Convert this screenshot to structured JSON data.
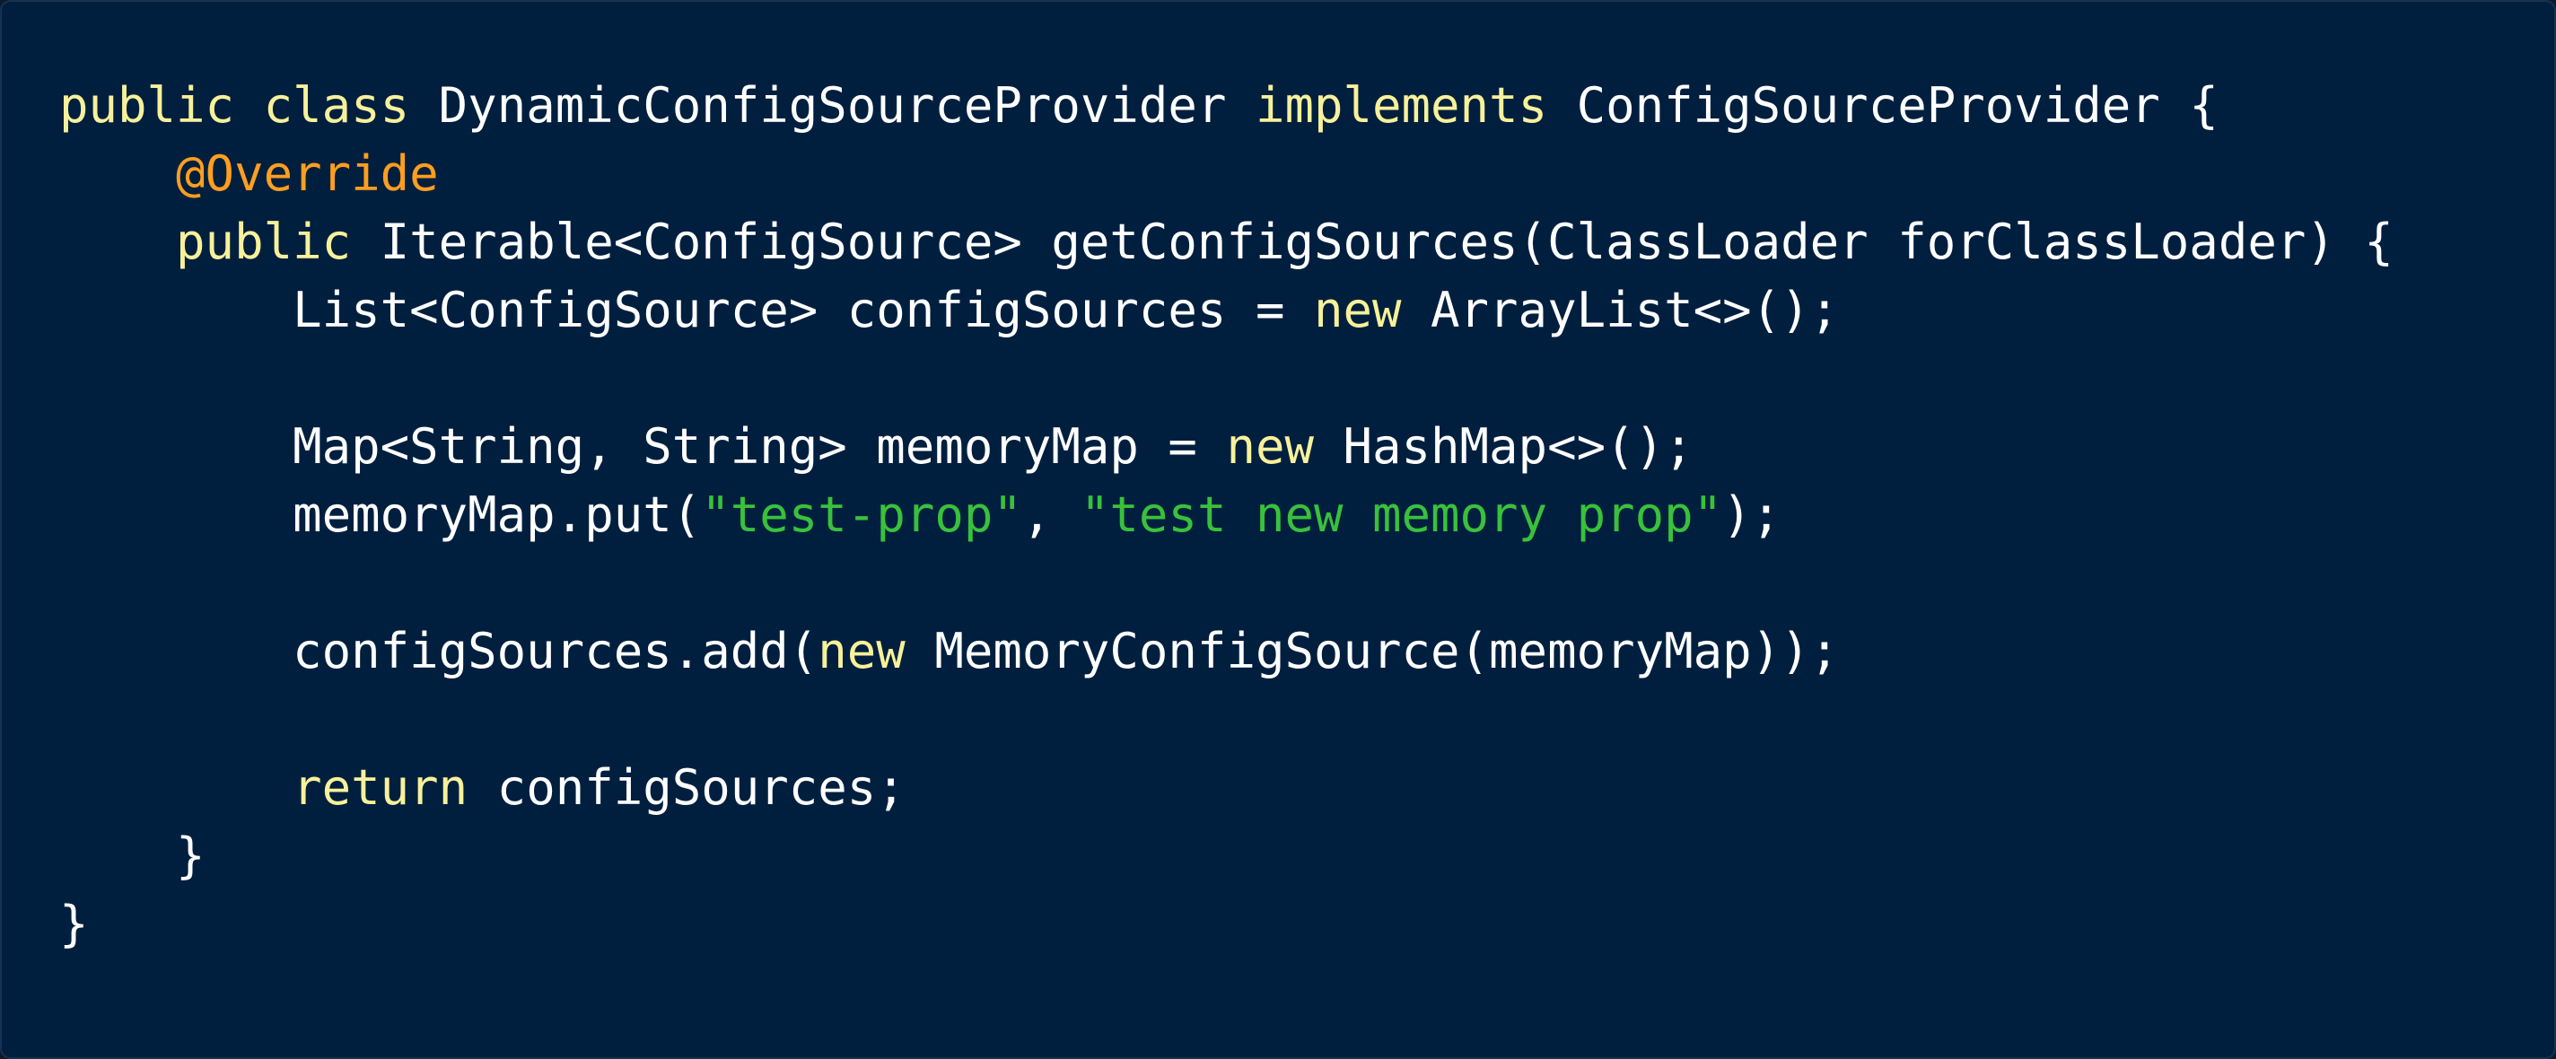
{
  "colors": {
    "background": "#001f3f",
    "plain": "#ffffff",
    "keyword": "#f8f19a",
    "annotation": "#ff9e1f",
    "string": "#39c13b"
  },
  "code": {
    "language": "java",
    "lines": [
      [
        {
          "t": "kw",
          "v": "public"
        },
        {
          "t": "plain",
          "v": " "
        },
        {
          "t": "kw",
          "v": "class"
        },
        {
          "t": "plain",
          "v": " DynamicConfigSourceProvider "
        },
        {
          "t": "kw",
          "v": "implements"
        },
        {
          "t": "plain",
          "v": " ConfigSourceProvider {"
        }
      ],
      [
        {
          "t": "plain",
          "v": "    "
        },
        {
          "t": "ann",
          "v": "@Override"
        }
      ],
      [
        {
          "t": "plain",
          "v": "    "
        },
        {
          "t": "kw",
          "v": "public"
        },
        {
          "t": "plain",
          "v": " Iterable<ConfigSource> getConfigSources(ClassLoader forClassLoader) {"
        }
      ],
      [
        {
          "t": "plain",
          "v": "        List<ConfigSource> configSources = "
        },
        {
          "t": "kw",
          "v": "new"
        },
        {
          "t": "plain",
          "v": " ArrayList<>();"
        }
      ],
      [],
      [
        {
          "t": "plain",
          "v": "        Map<String, String> memoryMap = "
        },
        {
          "t": "kw",
          "v": "new"
        },
        {
          "t": "plain",
          "v": " HashMap<>();"
        }
      ],
      [
        {
          "t": "plain",
          "v": "        memoryMap.put("
        },
        {
          "t": "str",
          "v": "\"test-prop\""
        },
        {
          "t": "plain",
          "v": ", "
        },
        {
          "t": "str",
          "v": "\"test new memory prop\""
        },
        {
          "t": "plain",
          "v": ");"
        }
      ],
      [],
      [
        {
          "t": "plain",
          "v": "        configSources.add("
        },
        {
          "t": "kw",
          "v": "new"
        },
        {
          "t": "plain",
          "v": " MemoryConfigSource(memoryMap));"
        }
      ],
      [],
      [
        {
          "t": "plain",
          "v": "        "
        },
        {
          "t": "kw",
          "v": "return"
        },
        {
          "t": "plain",
          "v": " configSources;"
        }
      ],
      [
        {
          "t": "plain",
          "v": "    }"
        }
      ],
      [
        {
          "t": "plain",
          "v": "}"
        }
      ]
    ]
  }
}
